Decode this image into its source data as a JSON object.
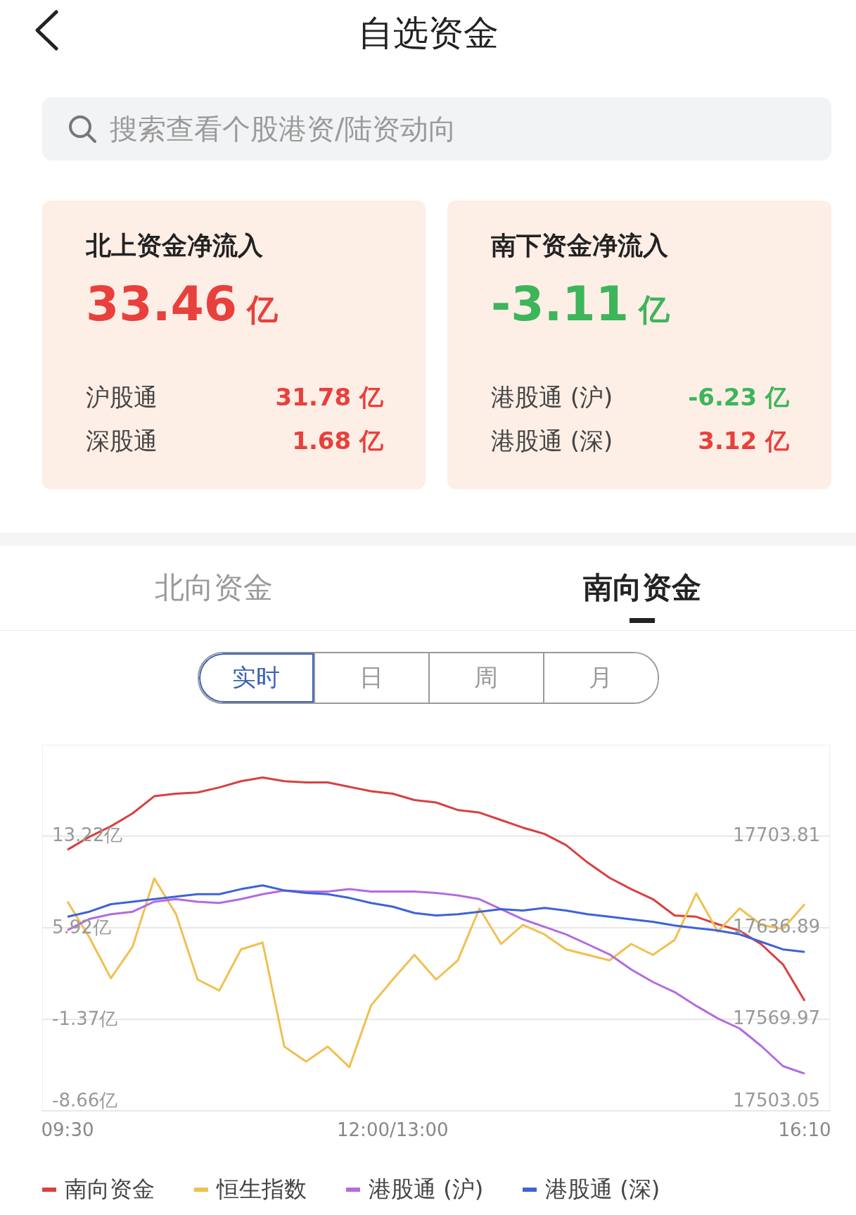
{
  "header": {
    "title": "自选资金"
  },
  "search": {
    "placeholder": "搜索查看个股港资/陆资动向"
  },
  "cards": [
    {
      "title": "北上资金净流入",
      "amount": "33.46",
      "unit": "亿",
      "color": "#e8403c",
      "rows": [
        {
          "label": "沪股通",
          "value": "31.78 亿",
          "color": "#e8403c"
        },
        {
          "label": "深股通",
          "value": "1.68 亿",
          "color": "#e8403c"
        }
      ]
    },
    {
      "title": "南下资金净流入",
      "amount": "-3.11",
      "unit": "亿",
      "color": "#3db55a",
      "rows": [
        {
          "label": "港股通 (沪)",
          "value": "-6.23 亿",
          "color": "#3db55a"
        },
        {
          "label": "港股通 (深)",
          "value": "3.12 亿",
          "color": "#e8403c"
        }
      ]
    }
  ],
  "tabs": [
    {
      "label": "北向资金",
      "selected": false
    },
    {
      "label": "南向资金",
      "selected": true
    }
  ],
  "periods": [
    {
      "label": "实时",
      "selected": true
    },
    {
      "label": "日",
      "selected": false
    },
    {
      "label": "周",
      "selected": false
    },
    {
      "label": "月",
      "selected": false
    }
  ],
  "chart": {
    "chart_data": {
      "type": "line",
      "categories": [
        "09:30",
        null,
        null,
        null,
        null,
        null,
        null,
        null,
        null,
        null,
        null,
        null,
        null,
        null,
        null,
        "12:00/13:00",
        null,
        null,
        null,
        null,
        null,
        null,
        null,
        null,
        null,
        null,
        null,
        null,
        null,
        null,
        null,
        null,
        null,
        null,
        "16:10"
      ],
      "ylim": [
        -8.66,
        20.5
      ],
      "grid": true,
      "yticks": [
        {
          "value": 13.22,
          "label": "13.22亿"
        },
        {
          "value": 5.92,
          "label": "5.92亿"
        },
        {
          "value": -1.37,
          "label": "-1.37亿"
        },
        {
          "value": -8.66,
          "label": "-8.66亿"
        }
      ],
      "y2lim": [
        17503.05,
        17770.6
      ],
      "y2ticks": [
        {
          "value": 17703.81,
          "label": "17703.81"
        },
        {
          "value": 17636.89,
          "label": "17636.89"
        },
        {
          "value": 17569.97,
          "label": "17569.97"
        },
        {
          "value": 17503.05,
          "label": "17503.05"
        }
      ],
      "series": [
        {
          "name": "南向资金",
          "color": "#d94040",
          "values": [
            12.14,
            13.16,
            14.0,
            15.03,
            16.4,
            16.6,
            16.7,
            17.1,
            17.6,
            17.9,
            17.6,
            17.5,
            17.5,
            17.15,
            16.8,
            16.6,
            16.1,
            15.9,
            15.3,
            15.1,
            14.5,
            13.9,
            13.4,
            12.5,
            11.1,
            9.9,
            9.0,
            8.2,
            6.9,
            6.8,
            6.2,
            5.7,
            4.6,
            3.0,
            0.1
          ]
        },
        {
          "name": "恒生指数",
          "color": "#f0c050",
          "axis": "y2",
          "values": [
            17656,
            17630,
            17600,
            17623,
            17673,
            17647,
            17599,
            17591,
            17621,
            17626,
            17550,
            17539,
            17550,
            17535,
            17580,
            17599,
            17617,
            17599,
            17613,
            17651,
            17625,
            17639,
            17632,
            17621,
            17617,
            17613,
            17625,
            17617,
            17628,
            17662,
            17634,
            17651,
            17639,
            17636,
            17654
          ]
        },
        {
          "name": "港股通 (沪)",
          "color": "#b36be0",
          "values": [
            5.73,
            6.62,
            7.0,
            7.2,
            8.0,
            8.2,
            8.0,
            7.9,
            8.2,
            8.6,
            8.9,
            8.8,
            8.8,
            9.0,
            8.8,
            8.8,
            8.8,
            8.7,
            8.5,
            8.2,
            7.4,
            6.6,
            6.0,
            5.4,
            4.6,
            3.8,
            2.6,
            1.6,
            0.8,
            -0.3,
            -1.3,
            -2.1,
            -3.5,
            -5.1,
            -5.7
          ]
        },
        {
          "name": "港股通 (深)",
          "color": "#3d63d6",
          "values": [
            6.8,
            7.2,
            7.8,
            8.0,
            8.2,
            8.4,
            8.6,
            8.6,
            9.0,
            9.3,
            8.9,
            8.7,
            8.6,
            8.3,
            7.9,
            7.6,
            7.1,
            6.9,
            7.0,
            7.2,
            7.4,
            7.3,
            7.5,
            7.3,
            7.0,
            6.8,
            6.6,
            6.4,
            6.1,
            5.9,
            5.7,
            5.4,
            4.8,
            4.2,
            4.0
          ]
        }
      ]
    }
  }
}
